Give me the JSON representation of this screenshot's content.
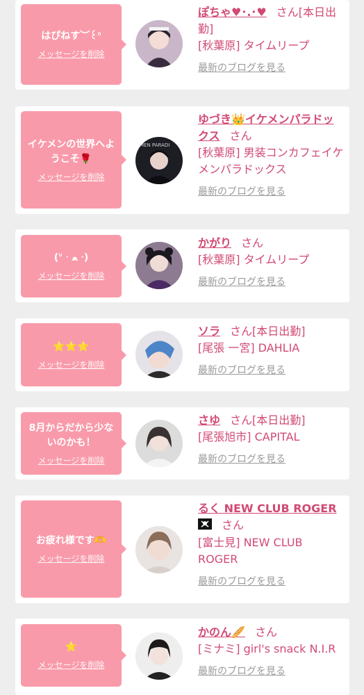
{
  "common": {
    "delete_label": "メッセージを削除",
    "blog_label": "最新のブログを見る",
    "san_label": "さん"
  },
  "colors": {
    "accent": "#d14a74",
    "bubble": "#f99aaa",
    "background": "#eeeeee",
    "blog_link": "#9a9a9a"
  },
  "cards": [
    {
      "message": "はぴねす︶꒰ᐢ",
      "name": "ぽちゃ♥･.･♥",
      "work_tag": "[本日出勤]",
      "shop": "[秋葉原] タイムリープ"
    },
    {
      "message": "イケメンの世界へようこそ🌹",
      "name": "ゆづき👑イケメンパラドックス",
      "work_tag": "",
      "shop": "[秋葉原] 男装コンカフェイケメンパラドックス"
    },
    {
      "message": "(ᐡ ᐧ ﻌ ᐧ)",
      "name": "かがり",
      "work_tag": "",
      "shop": "[秋葉原] タイムリープ"
    },
    {
      "message": "⭐⭐⭐",
      "name": "ソラ",
      "work_tag": "[本日出勤]",
      "shop": "[尾張 一宮] DAHLIA"
    },
    {
      "message": "8月からだから少ないのかも！",
      "name": "さゆ",
      "work_tag": "[本日出勤]",
      "shop": "[尾張旭市] CAPITAL"
    },
    {
      "message": "お疲れ様です🫶",
      "name": "るく NEW CLUB ROGER",
      "name_icon": "pirate-flag-icon",
      "work_tag": "",
      "shop": "[富士見] NEW CLUB ROGER"
    },
    {
      "message": "⭐",
      "name": "かのん🥖",
      "work_tag": "",
      "shop": "[ミナミ] girl's snack N.I.R"
    }
  ]
}
